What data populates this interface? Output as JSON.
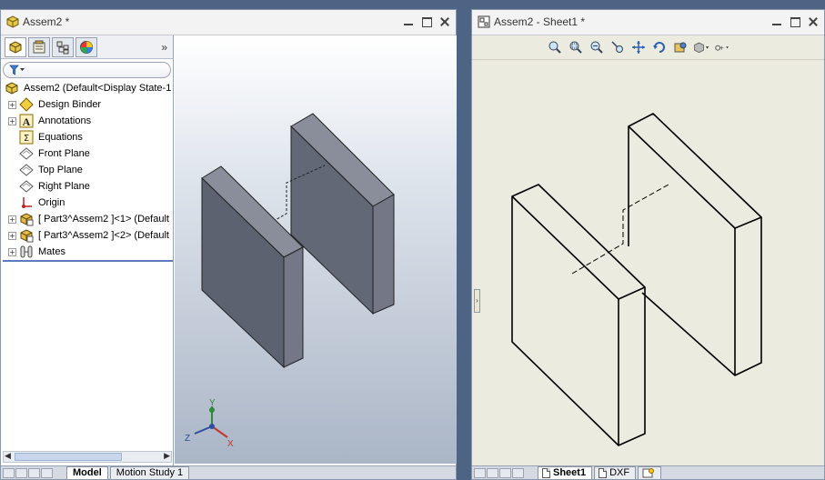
{
  "left_window": {
    "title": "Assem2 *",
    "feature_tree": {
      "root": "Assem2  (Default<Display State-1",
      "items": [
        {
          "label": "Design Binder",
          "icon": "design-binder-icon",
          "expandable": true
        },
        {
          "label": "Annotations",
          "icon": "annotations-icon",
          "expandable": true
        },
        {
          "label": "Equations",
          "icon": "equations-icon",
          "expandable": false
        },
        {
          "label": "Front Plane",
          "icon": "plane-icon",
          "expandable": false
        },
        {
          "label": "Top Plane",
          "icon": "plane-icon",
          "expandable": false
        },
        {
          "label": "Right Plane",
          "icon": "plane-icon",
          "expandable": false
        },
        {
          "label": "Origin",
          "icon": "origin-icon",
          "expandable": false
        },
        {
          "label": "[ Part3^Assem2 ]<1> (Default",
          "icon": "part-icon",
          "expandable": true
        },
        {
          "label": "[ Part3^Assem2 ]<2> (Default",
          "icon": "part-icon",
          "expandable": true
        },
        {
          "label": "Mates",
          "icon": "mates-icon",
          "expandable": true
        }
      ]
    },
    "bottom_tabs": [
      "Model",
      "Motion Study 1"
    ],
    "triad_labels": {
      "y": "Y",
      "z": "Z",
      "x": "X"
    },
    "tab_overflow": "»",
    "panel_handle": "‹"
  },
  "right_window": {
    "title": "Assem2 - Sheet1 *",
    "sheet_tabs": [
      "Sheet1",
      "DXF"
    ],
    "toolbar_icons": [
      "zoom-to-fit-icon",
      "zoom-to-area-icon",
      "zoom-in-out-icon",
      "zoom-to-selection-icon",
      "pan-icon",
      "rotate-icon",
      "3d-drawing-view-icon",
      "display-style-icon",
      "hide-show-icon"
    ],
    "panel_handle": "›"
  },
  "colors": {
    "desktop": "#4d6485",
    "sheet_background": "#ecebe0",
    "part_face_dark": "#5a5f6e",
    "part_face_light": "#787c8a",
    "part_face_top": "#8a8e9a",
    "triad_x": "#c0392b",
    "triad_y": "#2f8a3a",
    "triad_z": "#2c4f9e"
  }
}
